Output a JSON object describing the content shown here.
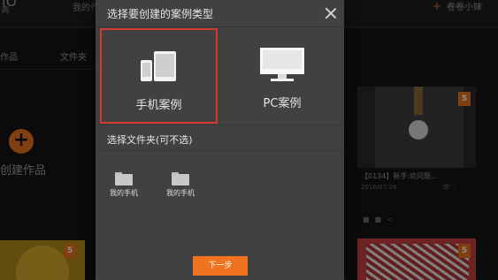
{
  "background_app": {
    "logo_mark": "(O",
    "logo_text": "网",
    "nav_item": "我的作",
    "user_name": "卷卷小妹",
    "tabs": [
      "作品",
      "文件夹"
    ],
    "create_label": "创建作品",
    "card": {
      "title": "【0134】新手:欢问题...",
      "date": "2016/07/28",
      "meta": "👁 ♡"
    },
    "badge": "5"
  },
  "modal": {
    "title": "选择要创建的案例类型",
    "case_types": [
      {
        "label": "手机案例",
        "selected": true,
        "icon": "mobile-tablet-icon"
      },
      {
        "label": "PC案例",
        "selected": false,
        "icon": "monitor-icon"
      }
    ],
    "folder_heading": "选择文件夹(可不选)",
    "folders": [
      {
        "label": "我的手机",
        "icon": "folder-icon"
      },
      {
        "label": "我的手机",
        "icon": "folder-icon"
      }
    ],
    "next_label": "下一步"
  },
  "colors": {
    "accent": "#f0731f",
    "selection_border": "#d23b32",
    "modal_bg": "#414141"
  }
}
